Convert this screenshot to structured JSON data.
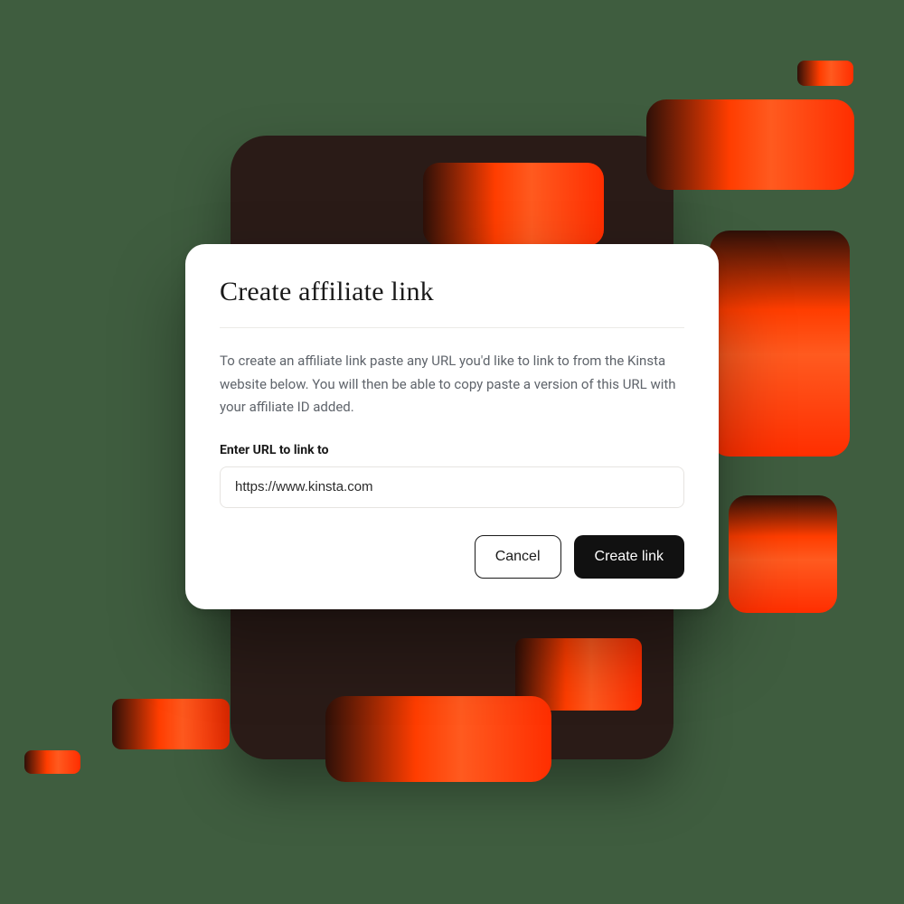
{
  "modal": {
    "title": "Create affiliate link",
    "description": "To create an affiliate link paste any URL you'd like to link to from the Kinsta website below. You will then be able to copy paste a version of this URL with your affiliate ID added.",
    "field_label": "Enter URL to link to",
    "url_value": "https://www.kinsta.com",
    "cancel_label": "Cancel",
    "submit_label": "Create link"
  },
  "colors": {
    "page_bg": "#3f5d3f",
    "backdrop": "#2a1b17",
    "accent_gradient_start": "#2e1008",
    "accent_gradient_end": "#ff3d00",
    "modal_bg": "#ffffff",
    "primary_button": "#111111"
  }
}
